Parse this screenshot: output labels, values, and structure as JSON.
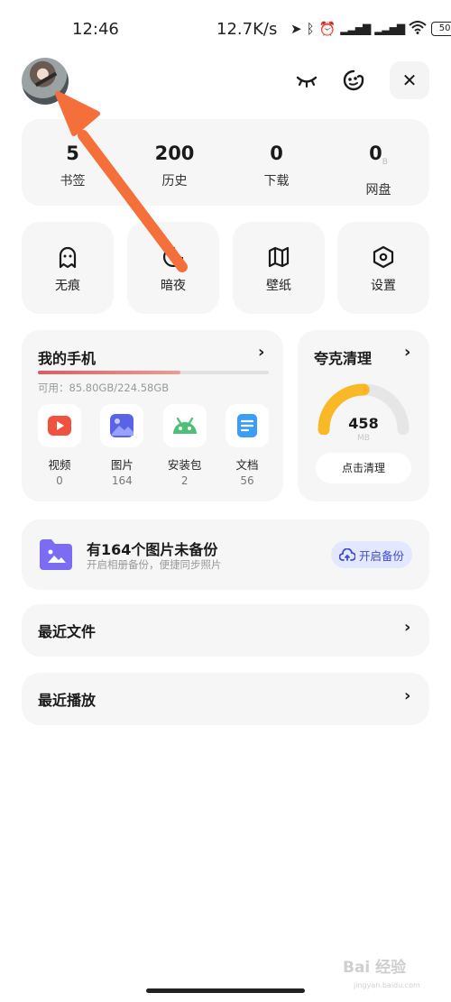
{
  "status_bar": {
    "time": "12:46",
    "net_speed": "12.7K/s",
    "icons": [
      "location-icon",
      "bluetooth-icon",
      "alarm-icon",
      "signal-icon",
      "signal-icon",
      "wifi-icon"
    ],
    "battery": "50"
  },
  "header": {
    "buttons": [
      "eye-closed-icon",
      "theme-icon",
      "close-icon"
    ],
    "close_glyph": "✕"
  },
  "stats": [
    {
      "value": "5",
      "label": "书签",
      "unit": ""
    },
    {
      "value": "200",
      "label": "历史",
      "unit": ""
    },
    {
      "value": "0",
      "label": "下载",
      "unit": ""
    },
    {
      "value": "0",
      "label": "网盘",
      "unit": "B"
    }
  ],
  "tiles": [
    {
      "label": "无痕",
      "icon": "ghost-icon"
    },
    {
      "label": "暗夜",
      "icon": "moon-icon"
    },
    {
      "label": "壁纸",
      "icon": "map-icon"
    },
    {
      "label": "设置",
      "icon": "settings-icon"
    }
  ],
  "my_phone": {
    "title": "我的手机",
    "chevron": "›",
    "available": "可用：85.80GB/224.58GB",
    "used_fraction": 0.618,
    "apps": [
      {
        "label": "视频",
        "count": "0",
        "icon": "video-icon",
        "color": "#f0523d"
      },
      {
        "label": "图片",
        "count": "164",
        "icon": "image-icon",
        "color": "#5a63e6"
      },
      {
        "label": "安装包",
        "count": "2",
        "icon": "android-icon",
        "color": "#4fbf77"
      },
      {
        "label": "文档",
        "count": "56",
        "icon": "document-icon",
        "color": "#3b9df5"
      }
    ]
  },
  "clean": {
    "title": "夸克清理",
    "chevron": "›",
    "value": "458",
    "unit": "MB",
    "gauge_fraction": 0.5,
    "accent": "#f9b825",
    "button": "点击清理"
  },
  "backup": {
    "title": "有164个图片未备份",
    "subtitle": "开启相册备份，便捷同步照片",
    "button": "开启备份",
    "accent": "#3d4ccf"
  },
  "rows": [
    {
      "title": "最近文件",
      "chevron": "›"
    },
    {
      "title": "最近播放",
      "chevron": "›"
    }
  ],
  "watermark": {
    "text": "Bai 经验",
    "sub": "jingyan.baidu.com"
  },
  "annotation_arrow_color": "#f46f3a"
}
